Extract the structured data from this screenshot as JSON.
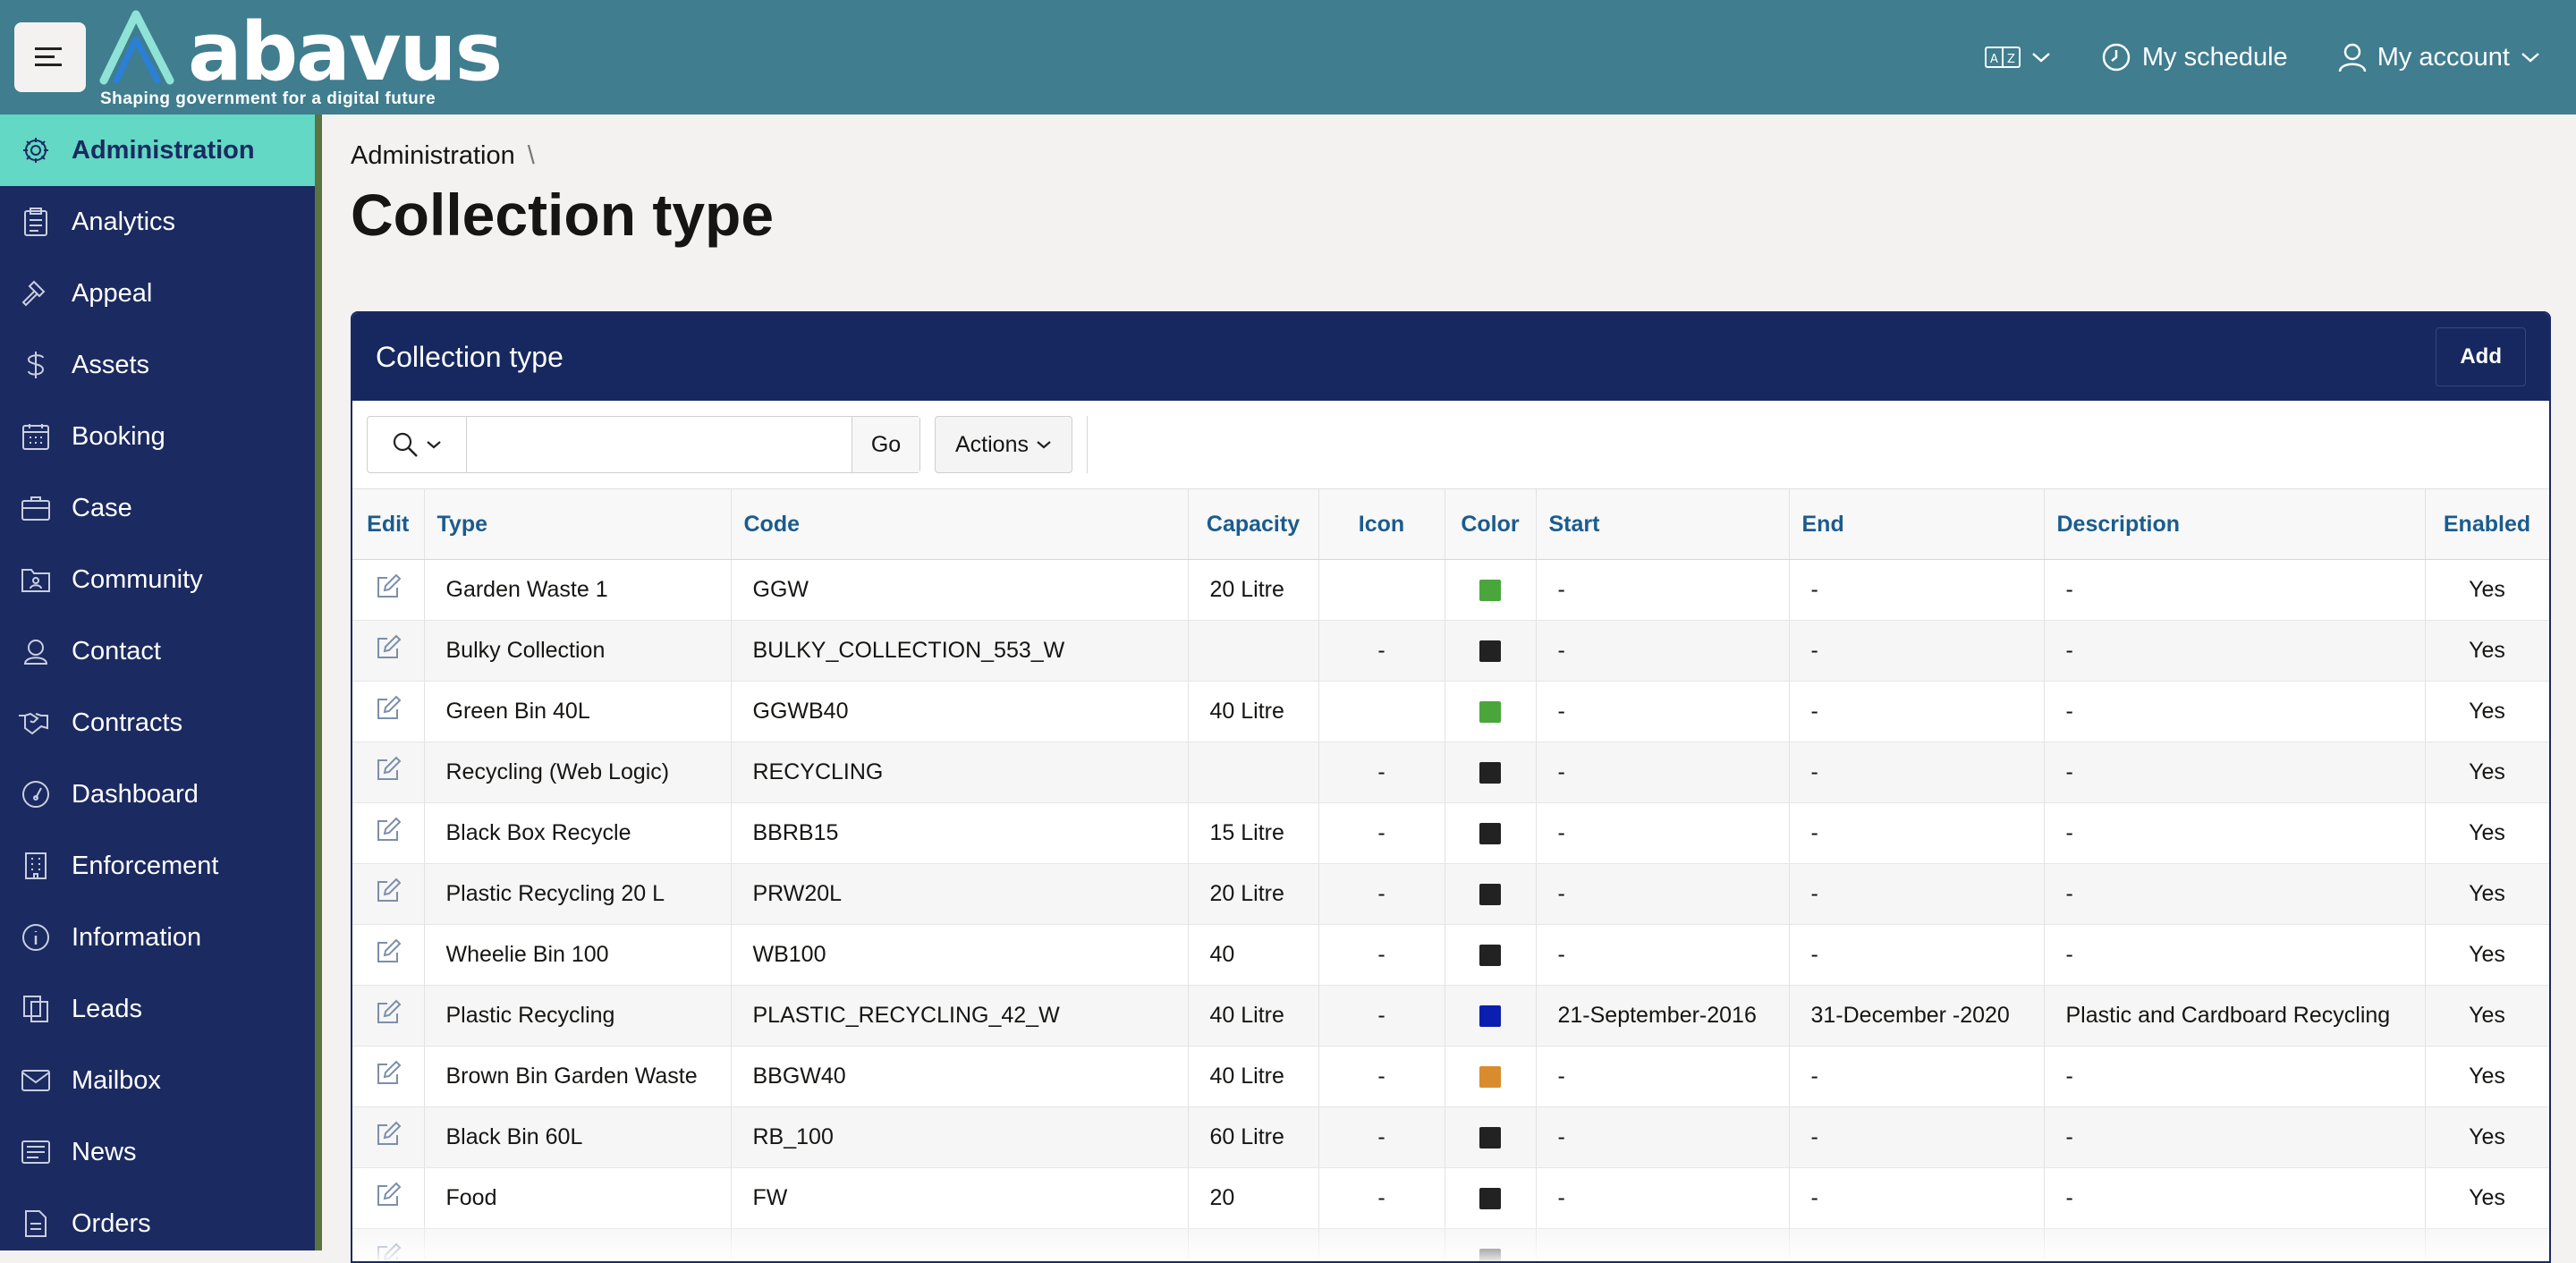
{
  "header": {
    "logo_word": "abavus",
    "logo_tagline": "Shaping government for a digital future",
    "schedule_label": "My schedule",
    "account_label": "My account"
  },
  "sidebar": {
    "items": [
      {
        "label": "Administration",
        "icon": "gear-icon",
        "active": true
      },
      {
        "label": "Analytics",
        "icon": "clipboard-icon"
      },
      {
        "label": "Appeal",
        "icon": "gavel-icon"
      },
      {
        "label": "Assets",
        "icon": "dollar-icon"
      },
      {
        "label": "Booking",
        "icon": "calendar-icon"
      },
      {
        "label": "Case",
        "icon": "briefcase-icon"
      },
      {
        "label": "Community",
        "icon": "community-folder-icon"
      },
      {
        "label": "Contact",
        "icon": "contact-icon"
      },
      {
        "label": "Contracts",
        "icon": "handshake-icon"
      },
      {
        "label": "Dashboard",
        "icon": "gauge-icon"
      },
      {
        "label": "Enforcement",
        "icon": "building-icon"
      },
      {
        "label": "Information",
        "icon": "info-icon"
      },
      {
        "label": "Leads",
        "icon": "copy-icon"
      },
      {
        "label": "Mailbox",
        "icon": "envelope-icon"
      },
      {
        "label": "News",
        "icon": "newspaper-icon"
      },
      {
        "label": "Orders",
        "icon": "document-icon"
      }
    ]
  },
  "main": {
    "breadcrumb": "Administration",
    "breadcrumb_sep": "\\",
    "title": "Collection type",
    "region_title": "Collection type",
    "add_label": "Add",
    "go_label": "Go",
    "actions_label": "Actions",
    "search_value": ""
  },
  "table": {
    "columns": [
      "Edit",
      "Type",
      "Code",
      "Capacity",
      "Icon",
      "Color",
      "Start",
      "End",
      "Description",
      "Enabled"
    ],
    "rows": [
      {
        "type": "Garden Waste 1",
        "code": "GGW",
        "capacity": "20 Litre",
        "icon": "",
        "color": "#4aa63b",
        "start": "-",
        "end": "-",
        "description": "-",
        "enabled": "Yes"
      },
      {
        "type": "Bulky Collection",
        "code": "BULKY_COLLECTION_553_W",
        "capacity": "",
        "icon": "-",
        "color": "#222222",
        "start": "-",
        "end": "-",
        "description": "-",
        "enabled": "Yes"
      },
      {
        "type": "Green Bin 40L",
        "code": "GGWB40",
        "capacity": "40 Litre",
        "icon": "",
        "color": "#4aa63b",
        "start": "-",
        "end": "-",
        "description": "-",
        "enabled": "Yes"
      },
      {
        "type": "Recycling (Web Logic)",
        "code": "RECYCLING",
        "capacity": "",
        "icon": "-",
        "color": "#222222",
        "start": "-",
        "end": "-",
        "description": "-",
        "enabled": "Yes"
      },
      {
        "type": "Black Box Recycle",
        "code": "BBRB15",
        "capacity": "15 Litre",
        "icon": "-",
        "color": "#222222",
        "start": "-",
        "end": "-",
        "description": "-",
        "enabled": "Yes"
      },
      {
        "type": "Plastic Recycling 20 L",
        "code": "PRW20L",
        "capacity": "20 Litre",
        "icon": "-",
        "color": "#222222",
        "start": "-",
        "end": "-",
        "description": "-",
        "enabled": "Yes"
      },
      {
        "type": "Wheelie Bin 100",
        "code": "WB100",
        "capacity": "40",
        "icon": "-",
        "color": "#222222",
        "start": "-",
        "end": "-",
        "description": "-",
        "enabled": "Yes"
      },
      {
        "type": "Plastic Recycling",
        "code": "PLASTIC_RECYCLING_42_W",
        "capacity": "40 Litre",
        "icon": "-",
        "color": "#0a1fb0",
        "start": "21-September-2016",
        "end": "31-December -2020",
        "description": "Plastic and Cardboard Recycling",
        "enabled": "Yes"
      },
      {
        "type": "Brown Bin Garden Waste",
        "code": "BBGW40",
        "capacity": "40 Litre",
        "icon": "-",
        "color": "#d98c2e",
        "start": "-",
        "end": "-",
        "description": "-",
        "enabled": "Yes"
      },
      {
        "type": "Black Bin 60L",
        "code": "RB_100",
        "capacity": "60 Litre",
        "icon": "-",
        "color": "#222222",
        "start": "-",
        "end": "-",
        "description": "-",
        "enabled": "Yes"
      },
      {
        "type": "Food",
        "code": "FW",
        "capacity": "20",
        "icon": "-",
        "color": "#222222",
        "start": "-",
        "end": "-",
        "description": "-",
        "enabled": "Yes"
      },
      {
        "type": "",
        "code": "",
        "capacity": "",
        "icon": "",
        "color": "#222222",
        "start": "",
        "end": "",
        "description": "",
        "enabled": ""
      }
    ]
  }
}
